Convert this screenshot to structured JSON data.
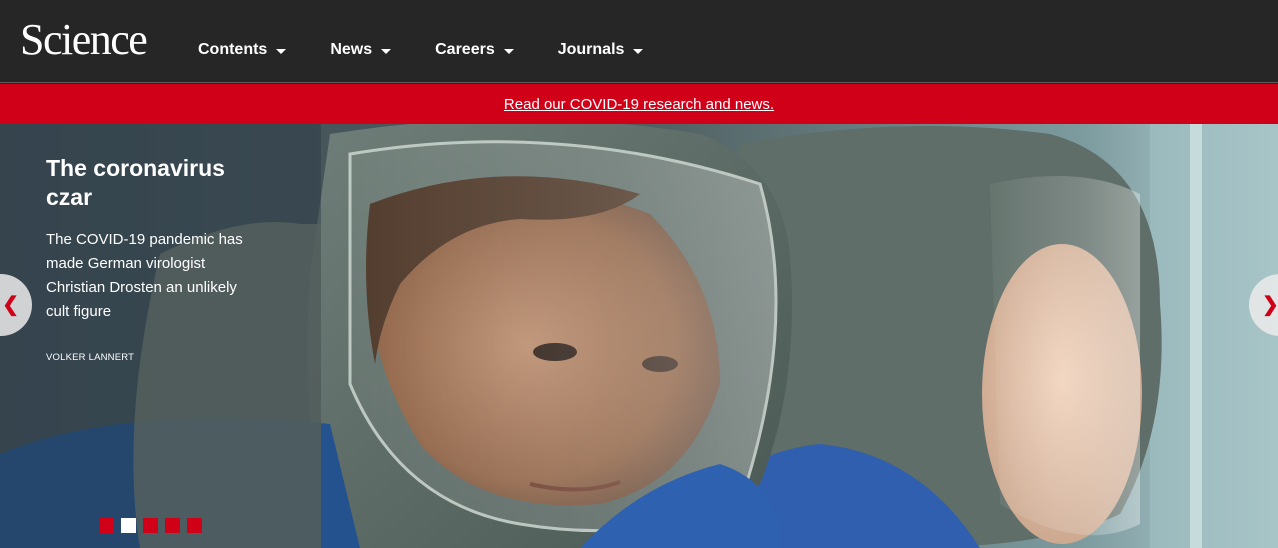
{
  "header": {
    "logo_text": "Science",
    "nav": [
      {
        "label": "Contents"
      },
      {
        "label": "News"
      },
      {
        "label": "Careers"
      },
      {
        "label": "Journals"
      }
    ]
  },
  "alert": {
    "link_text": "Read our COVID-19 research and news."
  },
  "hero": {
    "headline": "The coronavirus czar",
    "dek": "The COVID-19 pandemic has made German virologist Christian Drosten an unlikely cult figure",
    "credit": "VOLKER LANNERT",
    "prev_glyph": "❮",
    "next_glyph": "❯",
    "slides": {
      "count": 5,
      "active_index": 1
    }
  },
  "colors": {
    "header_bg": "#262626",
    "brand_red": "#d10019",
    "text": "#ffffff"
  }
}
